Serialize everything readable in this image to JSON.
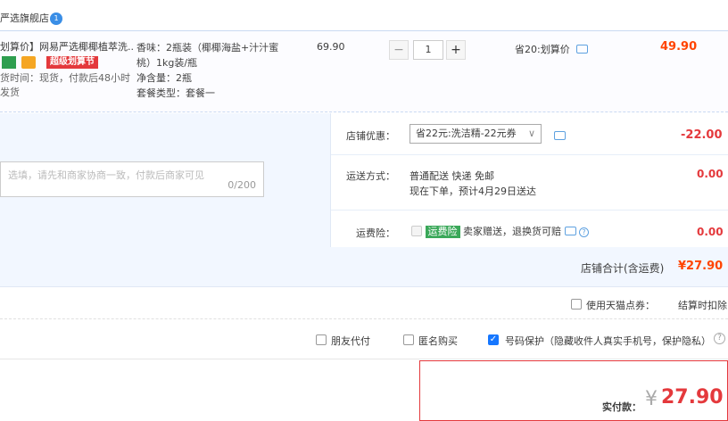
{
  "store": {
    "name": "严选旗舰店",
    "badge": "1"
  },
  "item": {
    "title": "划算价】网易严选椰椰植萃洗...",
    "promo_tag": "超级划算节",
    "ship_line1": "货时间：现货，付款后48小时",
    "ship_line2": "发货",
    "sku_lines": [
      "香味：2瓶装（椰椰海盐+汁汁蜜",
      "桃）1kg装/瓶",
      "净含量：2瓶",
      "套餐类型：套餐一"
    ],
    "unit_price": "69.90",
    "qty_minus": "−",
    "qty": "1",
    "qty_plus": "+",
    "discount_text": "省20:划算价",
    "total": "49.90"
  },
  "shop_promo": {
    "label": "店铺优惠：",
    "selected": "省22元:洗洁精-22元券",
    "amount": "-22.00"
  },
  "memo": {
    "placeholder": "选填，请先和商家协商一致，付款后商家可见",
    "count": "0/200"
  },
  "shipping": {
    "label": "运送方式：",
    "line1": "普通配送 快递 免邮",
    "line2": "现在下单，预计4月29日送达",
    "amount": "0.00"
  },
  "insurance": {
    "label": "运费险：",
    "badge": "运费险",
    "text": "卖家赠送，退换货可赔",
    "amount": "0.00"
  },
  "shop_total": {
    "label": "店铺合计(含运费)",
    "value": "¥27.90"
  },
  "tmall": {
    "label": "使用天猫点券：",
    "note": "结算时扣除"
  },
  "options": {
    "friend_pay": "朋友代付",
    "anonymous": "匿名购买",
    "privacy": "号码保护（隐藏收件人真实手机号，保护隐私）"
  },
  "payment": {
    "label": "实付款：",
    "currency": "¥",
    "value": "27.90"
  },
  "colors": {
    "accent": "#e4393c",
    "price_orange": "#ff4400",
    "link_blue": "#3a8ee6"
  }
}
